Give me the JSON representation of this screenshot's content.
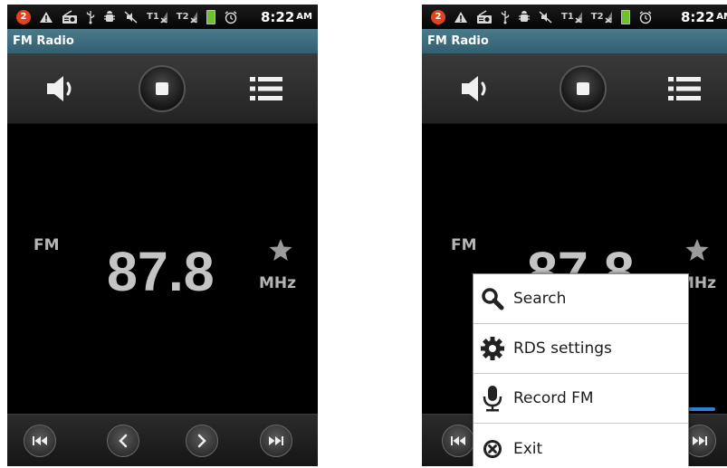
{
  "status_bar": {
    "notification_count": "2",
    "time": "8:22",
    "ampm": "AM",
    "sim1": "T1",
    "sim2": "T2"
  },
  "app": {
    "title": "FM Radio"
  },
  "toolbar": {
    "speaker_icon": "speaker-icon",
    "stop_icon": "stop-icon",
    "list_icon": "list-icon"
  },
  "tuner": {
    "band": "FM",
    "frequency": "87.8",
    "unit": "MHz",
    "favorite_icon": "star-icon"
  },
  "nav": {
    "icons": [
      "skip-previous-icon",
      "chevron-left-icon",
      "chevron-right-icon",
      "skip-next-icon"
    ]
  },
  "menu": {
    "items": [
      {
        "label": "Search",
        "icon": "search-icon"
      },
      {
        "label": "RDS settings",
        "icon": "gear-icon"
      },
      {
        "label": "Record FM",
        "icon": "microphone-icon"
      },
      {
        "label": "Exit",
        "icon": "exit-icon"
      }
    ]
  },
  "colors": {
    "titlebar": "#3f6f80",
    "accent_blue": "#2f7fd6",
    "badge_red": "#e2431c",
    "battery_green": "#6cc329"
  }
}
